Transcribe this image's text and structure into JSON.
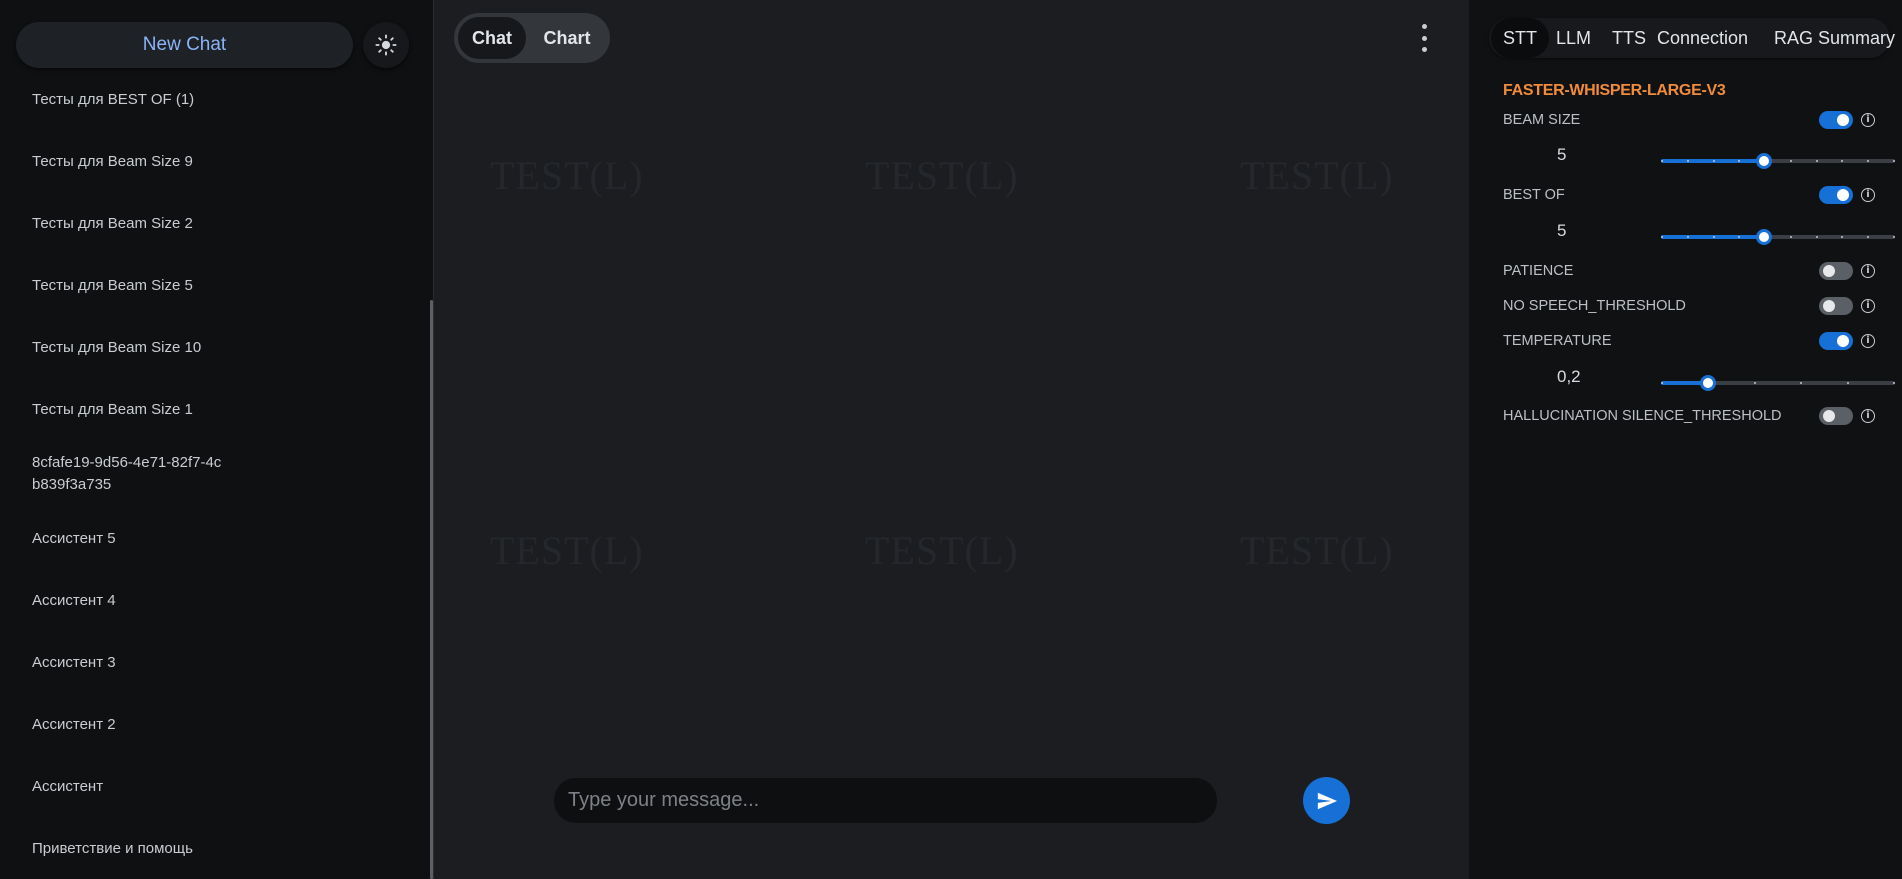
{
  "sidebar": {
    "new_chat_label": "New Chat",
    "theme_icon": "sun-icon",
    "chats": [
      "Тесты для BEST OF (1)",
      "Тесты для Beam Size 9",
      "Тесты для Beam Size 2",
      "Тесты для Beam Size 5",
      "Тесты для Beam Size 10",
      "Тесты для Beam Size 1",
      "8cfafe19-9d56-4e71-82f7-4cb839f3a735",
      "Ассистент 5",
      "Ассистент 4",
      "Ассистент 3",
      "Ассистент 2",
      "Ассистент",
      "Приветствие и помощь"
    ]
  },
  "main": {
    "tabs": [
      "Chat",
      "Chart"
    ],
    "active_tab": "Chat",
    "menu_icon": "more-vertical-icon",
    "watermark_text": "TEST(L)",
    "composer_placeholder": "Type your message...",
    "composer_value": "",
    "send_icon": "send-icon"
  },
  "panel": {
    "tabs": [
      "STT",
      "LLM",
      "TTS",
      "Connection",
      "RAG",
      "Summary"
    ],
    "active_tab": "STT",
    "model_name": "FASTER-WHISPER-LARGE-V3",
    "accent_color": "#1670d6",
    "model_color": "#f08c3a",
    "settings": [
      {
        "label": "BEAM SIZE",
        "enabled": true,
        "value": "5",
        "slider_fraction": 0.44
      },
      {
        "label": "BEST OF",
        "enabled": true,
        "value": "5",
        "slider_fraction": 0.44
      },
      {
        "label": "PATIENCE",
        "enabled": false
      },
      {
        "label": "NO SPEECH_THRESHOLD",
        "enabled": false
      },
      {
        "label": "TEMPERATURE",
        "enabled": true,
        "value": "0,2",
        "slider_fraction": 0.2
      },
      {
        "label": "HALLUCINATION SILENCE_THRESHOLD",
        "enabled": false
      }
    ]
  }
}
